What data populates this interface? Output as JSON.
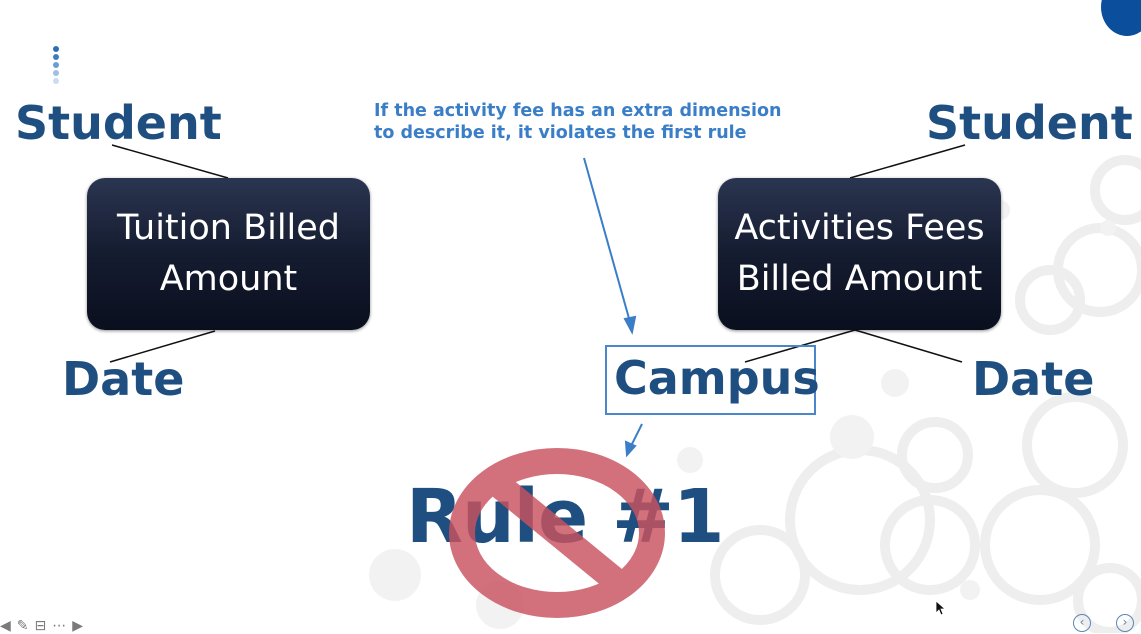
{
  "slide": {
    "left_star": {
      "dim_top": "Student",
      "fact": [
        "Tuition Billed",
        "Amount"
      ],
      "dim_bottom": "Date"
    },
    "right_star": {
      "dim_top": "Student",
      "fact": [
        "Activities Fees",
        "Billed Amount"
      ],
      "dim_bottom_left": "Campus",
      "dim_bottom_right": "Date"
    },
    "callout": [
      "If the activity fee has an extra dimension",
      "to describe it, it violates the first rule"
    ],
    "rule": "Rule #1"
  },
  "icons": {
    "prohibition": "no-sign-icon",
    "toolbar": [
      "back-arrow-icon",
      "pen-icon",
      "slides-icon",
      "more-icon",
      "forward-arrow-icon"
    ],
    "nav": [
      "prev-slide-icon",
      "next-slide-icon"
    ],
    "cursor": "mouse-pointer-icon"
  },
  "colors": {
    "label_blue": "#1f4e80",
    "callout_blue": "#3a7ec8",
    "box_dark": "#151c30",
    "prohibition_red": "#c9535f",
    "accent_corner": "#0b4f9c"
  }
}
